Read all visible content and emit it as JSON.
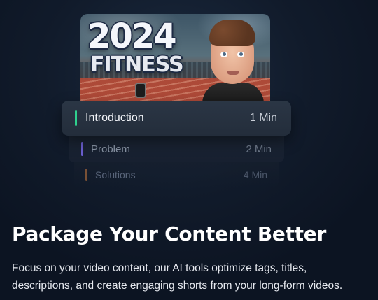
{
  "thumbnail": {
    "title_year": "2024",
    "title_word": "FITNESS"
  },
  "chapters": [
    {
      "label": "Introduction",
      "duration": "1 Min",
      "accent": "#2fd08e"
    },
    {
      "label": "Problem",
      "duration": "2 Min",
      "accent": "#6b5fd1"
    },
    {
      "label": "Solutions",
      "duration": "4 Min",
      "accent": "#a5673a"
    }
  ],
  "headline": "Package Your Content Better",
  "description": "Focus on your video content, our AI tools optimize tags, titles, descriptions, and create engaging shorts from your long-form videos."
}
